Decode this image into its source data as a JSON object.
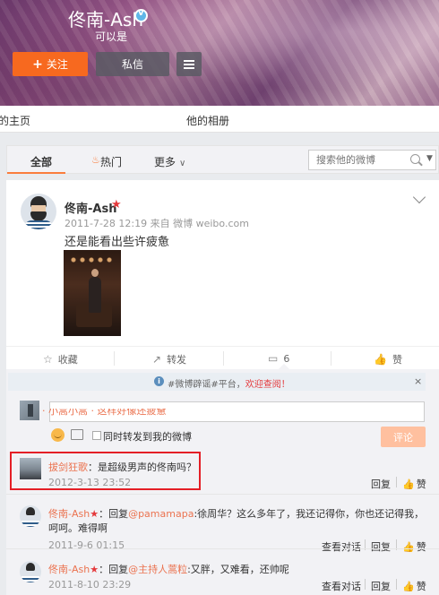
{
  "profile": {
    "name": "佟南-Ash",
    "bio": "可以是",
    "follow_label": "关注",
    "message_label": "私信"
  },
  "profile_tabs": {
    "home": "的主页",
    "album": "他的相册"
  },
  "filter": {
    "all": "全部",
    "hot": "热门",
    "more": "更多",
    "search_placeholder": "搜索他的微博"
  },
  "post": {
    "author": "佟南-Ash",
    "meta": "2011-7-28 12:19 来自 微博 weibo.com",
    "text": "还是能看出些许疲惫",
    "actions": {
      "favorite": "收藏",
      "forward": "转发",
      "comment_count": "6",
      "like": "赞"
    }
  },
  "notice": {
    "prefix": "#微博辟谣#平台，",
    "link": "欢迎查阅！"
  },
  "composer": {
    "repost_label": "同时转发到我的微博",
    "submit_label": "评论"
  },
  "comments": [
    {
      "name": "拔剑狂歌",
      "text": "：是超级男声的佟南吗？",
      "time": "2012-3-13 23:52",
      "reply": "回复",
      "like": "赞"
    },
    {
      "name": "佟南-Ash",
      "reply_prefix": "：回复",
      "mention": "@pamamapa",
      "text": ":徐周华？这么多年了，我还记得你，你也还记得我，呵呵。难得啊",
      "time": "2011-9-6 01:15",
      "view": "查看对话",
      "reply": "回复",
      "like": "赞"
    },
    {
      "name": "佟南-Ash",
      "reply_prefix": "：回复",
      "mention": "@主持人蒿粒",
      "text": ":又胖，又难看，还帅呢",
      "time": "2011-8-10 23:29",
      "view": "查看对话",
      "reply": "回复",
      "like": "赞"
    }
  ],
  "partial_comment": "· 小蒿小蒿 · 这样好像还疲惫",
  "colors": {
    "accent": "#f7691f",
    "link": "#eb7350",
    "highlight": "#e41f26"
  }
}
